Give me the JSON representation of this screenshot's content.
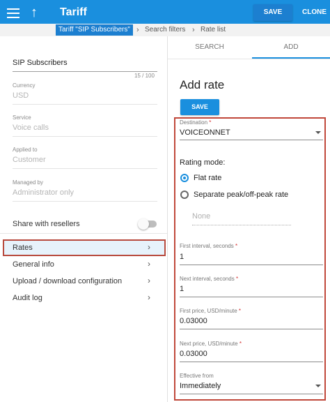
{
  "header": {
    "title": "Tariff",
    "save_label": "SAVE",
    "clone_label": "CLONE"
  },
  "breadcrumb": {
    "items": [
      "Tariff \"SIP Subscribers\"",
      "Search filters",
      "Rate list"
    ]
  },
  "left": {
    "name_value": "SIP Subscribers",
    "name_counter": "15 / 100",
    "fields": [
      {
        "label": "Currency",
        "value": "USD"
      },
      {
        "label": "Service",
        "value": "Voice calls"
      },
      {
        "label": "Applied to",
        "value": "Customer"
      },
      {
        "label": "Managed by",
        "value": "Administrator only"
      }
    ],
    "share_label": "Share with resellers",
    "nav": [
      "Rates",
      "General info",
      "Upload / download configuration",
      "Audit log"
    ]
  },
  "right": {
    "tabs": [
      "SEARCH",
      "ADD"
    ],
    "heading": "Add rate",
    "save_label": "SAVE",
    "destination_label": "Destination",
    "destination_value": "VOICEONNET",
    "rating_mode_label": "Rating mode:",
    "radio_flat": "Flat rate",
    "radio_peak": "Separate peak/off-peak rate",
    "none_placeholder": "None",
    "first_interval_label": "First interval, seconds",
    "first_interval_value": "1",
    "next_interval_label": "Next interval, seconds",
    "next_interval_value": "1",
    "first_price_label": "First price, USD/minute",
    "first_price_value": "0.03000",
    "next_price_label": "Next price, USD/minute",
    "next_price_value": "0.03000",
    "effective_label": "Effective from",
    "effective_value": "Immediately",
    "required_mark": "*"
  },
  "colors": {
    "primary": "#1a8fde",
    "highlight_border": "#c0473a"
  }
}
